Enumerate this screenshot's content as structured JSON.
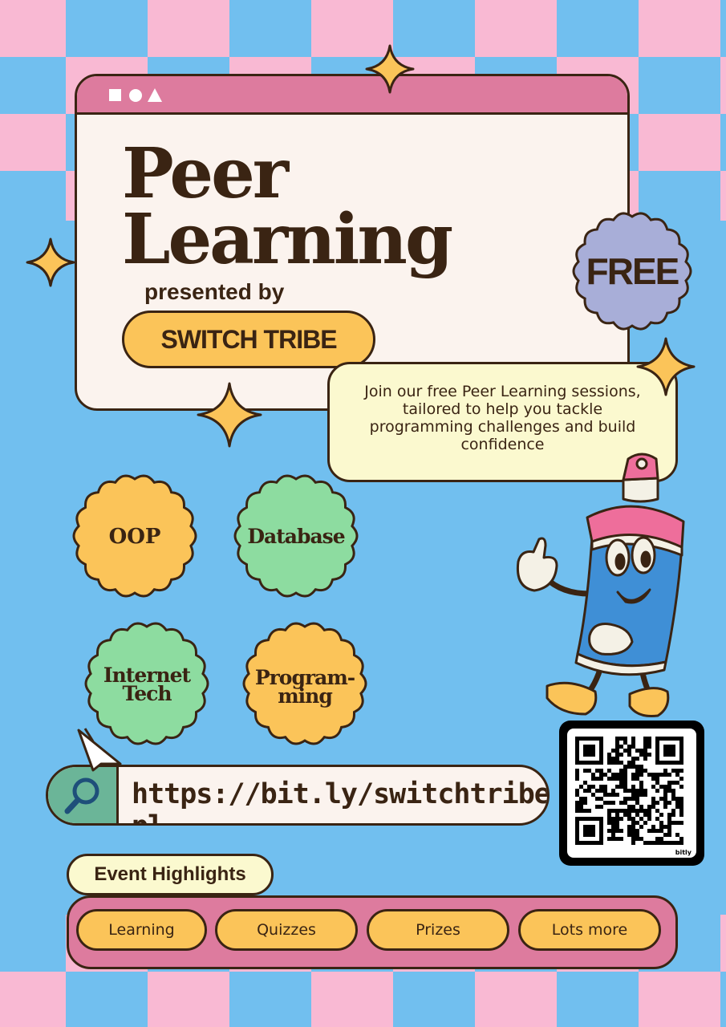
{
  "colors": {
    "background_blue": "#71bfef",
    "checker_pink": "#f9b9d3",
    "brown": "#3a2413",
    "window_pink": "#dd7b9e",
    "cream": "#fbf3ee",
    "yellow": "#fbc459",
    "green": "#8ddca0",
    "lavender": "#a8aed8",
    "pale_yellow": "#fbf9cf",
    "teal": "#6bb598"
  },
  "window": {
    "title_line1": "Peer",
    "title_line2": "Learning",
    "presented_by": "presented by",
    "organizer": "SWITCH TRIBE"
  },
  "free_badge": {
    "label": "FREE"
  },
  "description": {
    "text": "Join our free Peer Learning sessions, tailored to help you tackle programming challenges and build confidence"
  },
  "topics": [
    {
      "line1": "OOP",
      "line2": ""
    },
    {
      "line1": "Database",
      "line2": ""
    },
    {
      "line1": "Internet",
      "line2": "Tech"
    },
    {
      "line1": "Program-",
      "line2": "ming"
    }
  ],
  "url": {
    "text": "https://bit.ly/switchtribe-pl",
    "icon": "search-icon"
  },
  "qr": {
    "brand": "bitly"
  },
  "highlights": {
    "title": "Event Highlights",
    "items": [
      "Learning",
      "Quizzes",
      "Prizes",
      "Lots more"
    ]
  }
}
